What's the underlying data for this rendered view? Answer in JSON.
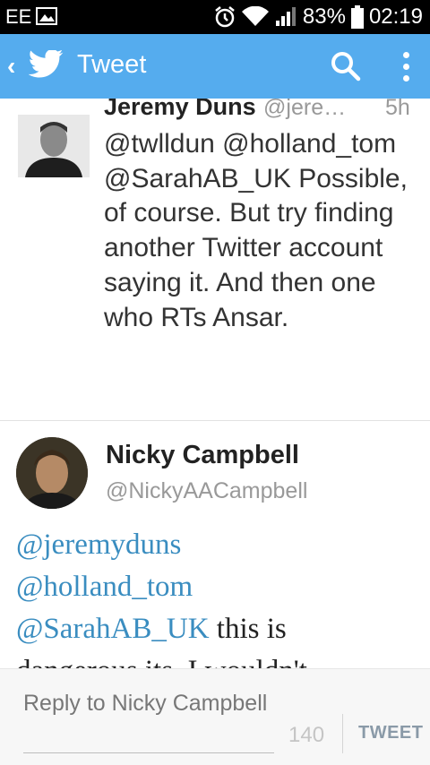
{
  "status_bar": {
    "carrier": "EE",
    "battery": "83%",
    "time": "02:19",
    "icons": [
      "image-notification-icon",
      "alarm-icon",
      "wifi-icon",
      "signal-icon",
      "battery-icon"
    ]
  },
  "action_bar": {
    "title": "Tweet",
    "color": "#55acee",
    "icons": [
      "back-chevron-icon",
      "twitter-bird-icon",
      "search-icon",
      "overflow-menu-icon"
    ]
  },
  "tweet1": {
    "name": "Jeremy Duns",
    "handle": "@jere…",
    "time": "5h",
    "text": "@twlldun @holland_tom @SarahAB_UK Possible, of course. But try finding another Twitter account saying it. And then one who RTs Ansar."
  },
  "tweet2": {
    "name": "Nicky Campbell",
    "handle": "@NickyAACampbell",
    "mentions": [
      "@jeremyduns",
      "@holland_tom",
      "@SarahAB_UK"
    ],
    "text_after": "this is",
    "text_partial": "dangerous its. I wouldn't"
  },
  "reply": {
    "placeholder": "Reply to Nicky Campbell",
    "char_count": "140",
    "send_label": "TWEET"
  },
  "colors": {
    "mention": "#3a8dc0",
    "muted": "#999999"
  }
}
